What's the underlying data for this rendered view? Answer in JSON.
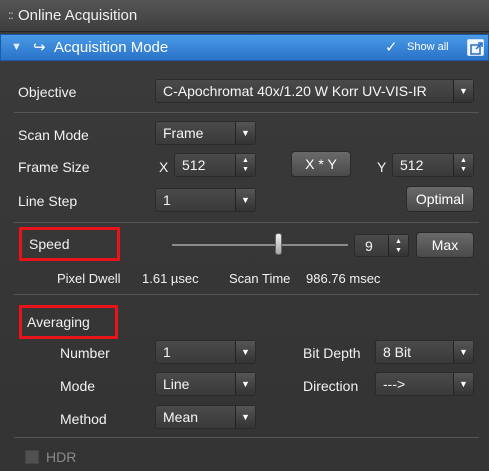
{
  "window": {
    "grip_icon": "::",
    "title": "Online Acquisition"
  },
  "section": {
    "chevron_icon": "▼",
    "arrow_icon": "↪",
    "title": "Acquisition Mode",
    "showall_check": "✓",
    "showall_label": "Show all"
  },
  "objective": {
    "label": "Objective",
    "value": "C-Apochromat 40x/1.20 W Korr UV-VIS-IR"
  },
  "scan": {
    "mode_label": "Scan Mode",
    "mode_value": "Frame",
    "frame_size_label": "Frame Size",
    "x_label": "X",
    "x_value": "512",
    "xy_button": "X * Y",
    "y_label": "Y",
    "y_value": "512",
    "line_step_label": "Line Step",
    "line_step_value": "1",
    "optimal_button": "Optimal"
  },
  "speed": {
    "label": "Speed",
    "slider_position": 0.6,
    "value": "9",
    "max_button": "Max",
    "pixel_dwell_label": "Pixel Dwell",
    "pixel_dwell_value": "1.61 µsec",
    "scan_time_label": "Scan Time",
    "scan_time_value": "986.76 msec"
  },
  "averaging": {
    "label": "Averaging",
    "number_label": "Number",
    "number_value": "1",
    "bit_depth_label": "Bit Depth",
    "bit_depth_value": "8 Bit",
    "mode_label": "Mode",
    "mode_value": "Line",
    "direction_label": "Direction",
    "direction_value": "--->",
    "method_label": "Method",
    "method_value": "Mean"
  },
  "hdr": {
    "label": "HDR",
    "checked": false
  },
  "colors": {
    "header_blue": "#2f7fd8",
    "highlight_red": "#e8141c",
    "panel_bg": "#383838"
  }
}
